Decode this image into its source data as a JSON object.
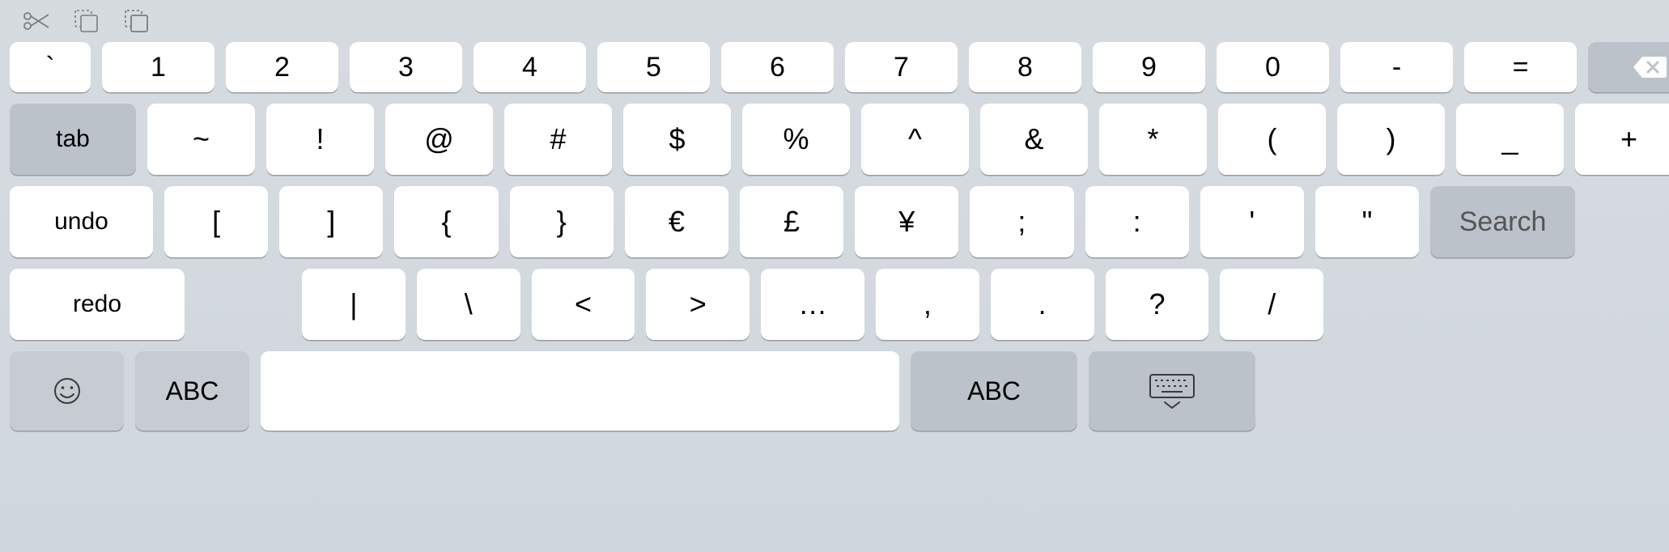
{
  "row1": {
    "keys": [
      "`",
      "1",
      "2",
      "3",
      "4",
      "5",
      "6",
      "7",
      "8",
      "9",
      "0",
      "-",
      "="
    ]
  },
  "row2": {
    "tab": "tab",
    "keys": [
      "~",
      "!",
      "@",
      "#",
      "$",
      "%",
      "^",
      "&",
      "*",
      "(",
      ")",
      "_",
      "+"
    ]
  },
  "row3": {
    "undo": "undo",
    "keys": [
      "[",
      "]",
      "{",
      "}",
      "€",
      "£",
      "¥",
      ";",
      ":",
      "'",
      "\""
    ],
    "search": "Search"
  },
  "row4": {
    "redo": "redo",
    "keys": [
      "|",
      "\\",
      "<",
      ">",
      "…",
      ",",
      ".",
      "?",
      "/"
    ]
  },
  "row5": {
    "abc_left": "ABC",
    "abc_right": "ABC"
  }
}
